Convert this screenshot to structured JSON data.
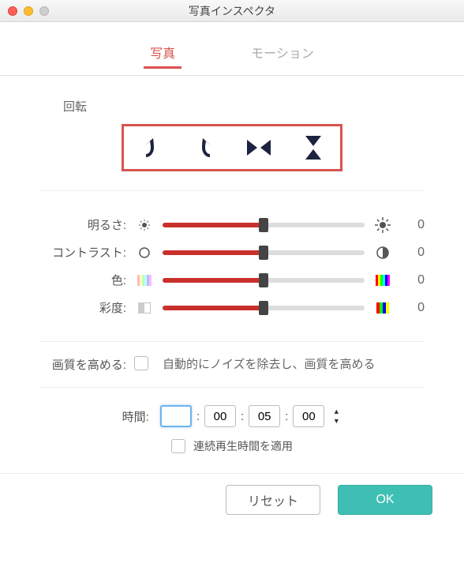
{
  "window": {
    "title": "写真インスペクタ"
  },
  "tabs": {
    "photo": "写真",
    "motion": "モーション"
  },
  "rotate": {
    "label": "回転"
  },
  "sliders": {
    "brightness": {
      "label": "明るさ:",
      "value": "0"
    },
    "contrast": {
      "label": "コントラスト:",
      "value": "0"
    },
    "color": {
      "label": "色:",
      "value": "0"
    },
    "saturation": {
      "label": "彩度:",
      "value": "0"
    }
  },
  "quality": {
    "label": "画質を高める:",
    "desc": "自動的にノイズを除去し、画質を高める"
  },
  "time": {
    "label": "時間:",
    "h": "",
    "m": "00",
    "s": "05",
    "f": "00",
    "loop_label": "連続再生時間を適用"
  },
  "buttons": {
    "reset": "リセット",
    "ok": "OK"
  },
  "colors": {
    "accent": "#d9534f",
    "ok": "#3fbfb4"
  }
}
